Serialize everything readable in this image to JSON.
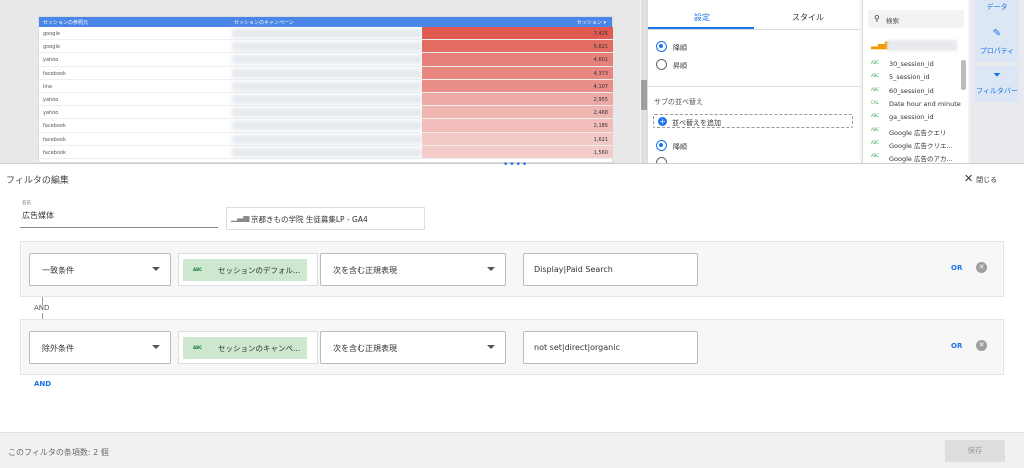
{
  "report": {
    "table": {
      "headers": [
        "セッションの参照元",
        "セッションのキャンペーン",
        "セッション ▾"
      ],
      "rows": [
        {
          "source": "google",
          "sessions": "7,425",
          "color": "#e05a52"
        },
        {
          "source": "google",
          "sessions": "5,621",
          "color": "#e36c63"
        },
        {
          "source": "yahoo",
          "sessions": "4,601",
          "color": "#e7807a"
        },
        {
          "source": "facebook",
          "sessions": "4,373",
          "color": "#e88680"
        },
        {
          "source": "line",
          "sessions": "4,107",
          "color": "#e98e88"
        },
        {
          "source": "yahoo",
          "sessions": "2,955",
          "color": "#eda9a5"
        },
        {
          "source": "yahoo",
          "sessions": "2,468",
          "color": "#efb5b1"
        },
        {
          "source": "facebook",
          "sessions": "2,185",
          "color": "#f1bcb9"
        },
        {
          "source": "facebook",
          "sessions": "1,621",
          "color": "#f3c9c7"
        },
        {
          "source": "facebook",
          "sessions": "1,560",
          "color": "#f3cbc9"
        }
      ]
    }
  },
  "settings_panel": {
    "tabs": [
      "設定",
      "スタイル"
    ],
    "sort_order": [
      "降順",
      "昇順"
    ],
    "secondary_sort_title": "サブの並べ替え",
    "add_sort_label": "並べ替えを追加",
    "secondary_order": [
      "降順"
    ]
  },
  "data_panel": {
    "search_placeholder": "検索",
    "fields": [
      {
        "type": "ABC",
        "name": "30_session_id"
      },
      {
        "type": "ABC",
        "name": "5_session_id"
      },
      {
        "type": "ABC",
        "name": "60_session_id"
      },
      {
        "type": "CAL",
        "name": "Date hour and minute"
      },
      {
        "type": "ABC",
        "name": "ga_session_id"
      },
      {
        "type": "ABC",
        "name": "Google 広告クエリ"
      },
      {
        "type": "ABC",
        "name": "Google 広告クリエ..."
      },
      {
        "type": "ABC",
        "name": "Google 広告のアカ..."
      }
    ]
  },
  "rail": {
    "data_label": "データ",
    "properties_label": "プロパティ",
    "filter_label": "フィルタバー"
  },
  "filter_editor": {
    "title": "フィルタの編集",
    "close_label": "閉じる",
    "name_label": "名前",
    "name_value": "広告媒体",
    "datasource": "京都きもの学院 生徒募集LP - GA4",
    "clauses": [
      {
        "condition": "一致条件",
        "dimension": "セッションのデフォル...",
        "operator": "次を含む正規表現",
        "value": "Display|Paid Search"
      },
      {
        "condition": "除外条件",
        "dimension": "セッションのキャンペ...",
        "operator": "次を含む正規表現",
        "value": "not set|direct|organic"
      }
    ],
    "and_label": "AND",
    "or_label": "OR",
    "add_and_label": "AND",
    "footer_text": "このフィルタの条項数: 2 個",
    "save_label": "保存"
  }
}
